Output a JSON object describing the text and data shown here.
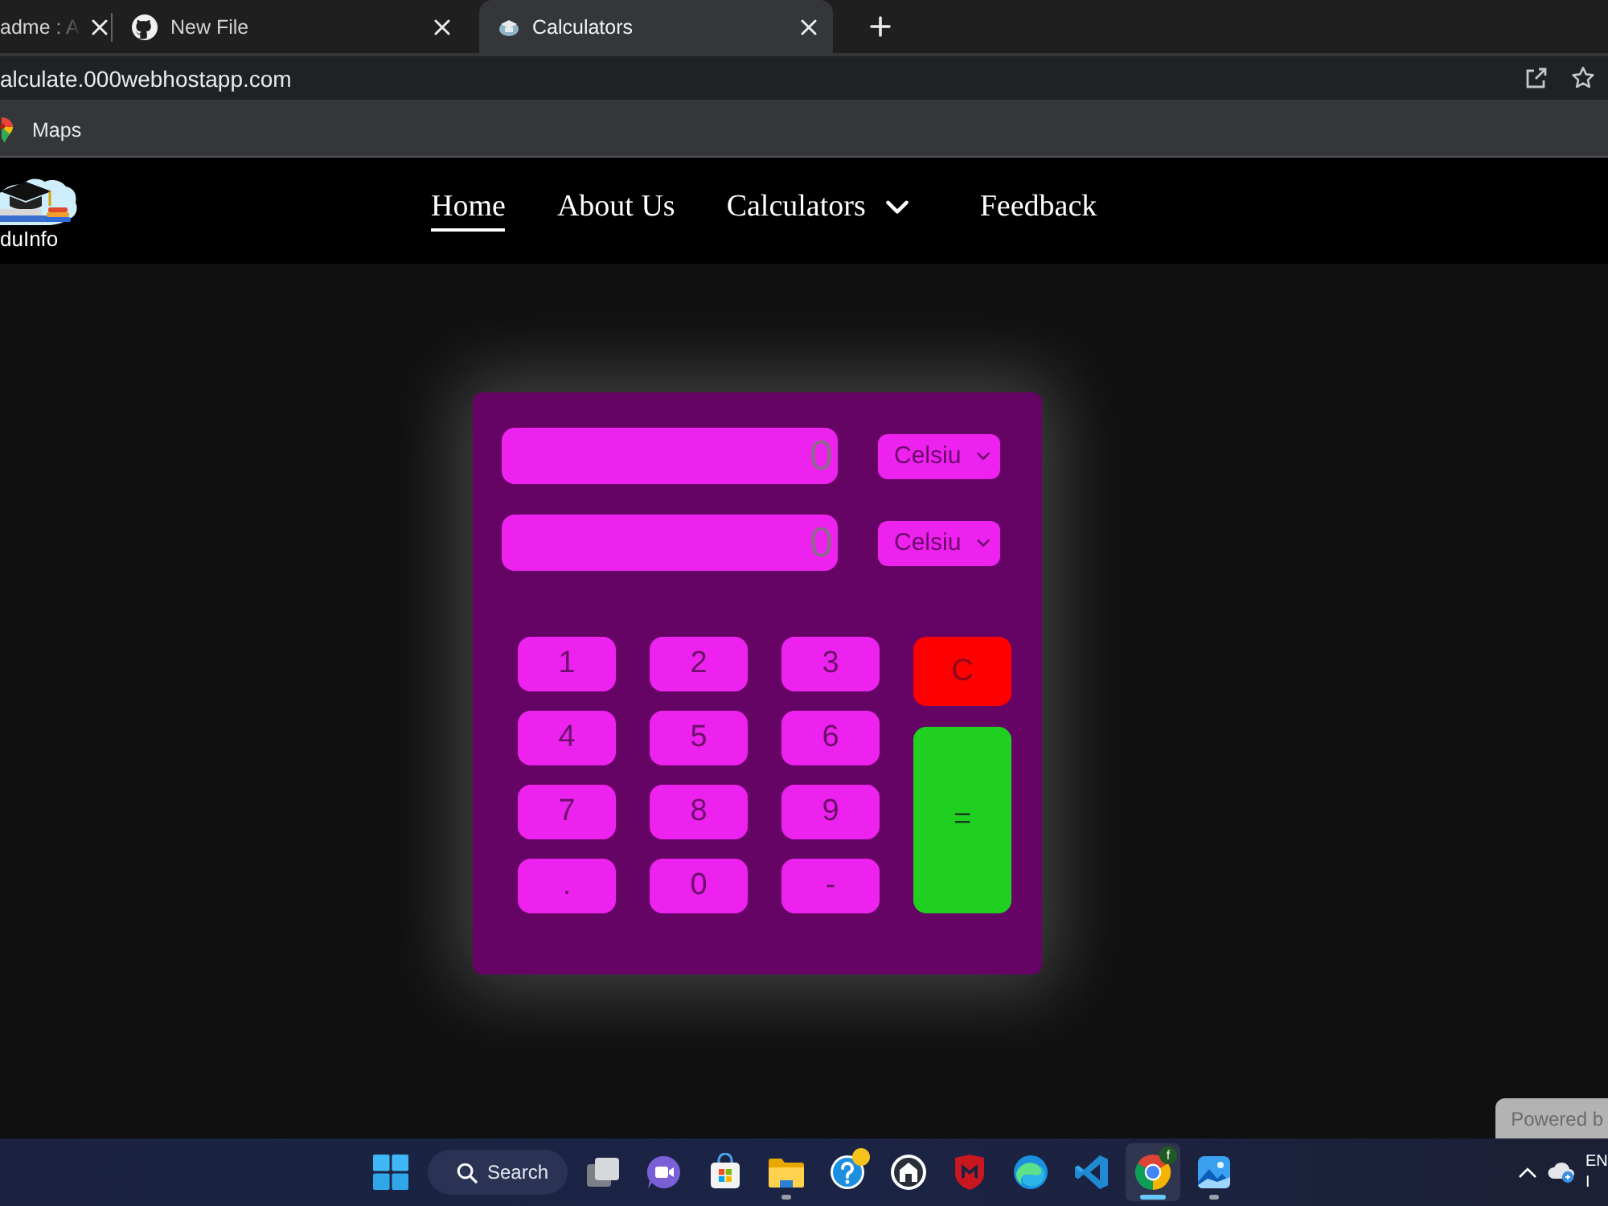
{
  "browser": {
    "tabs": [
      {
        "kind": "clipped",
        "title": "adme : A",
        "selected": false
      },
      {
        "kind": "code-host",
        "title": "New File",
        "selected": false
      },
      {
        "kind": "site",
        "title": "Calculators",
        "selected": true
      }
    ],
    "address": "alculate.000webhostapp.com",
    "bookmarks": [
      "Maps"
    ]
  },
  "site": {
    "logo_text": "duInfo",
    "nav": [
      {
        "label": "Home",
        "selected": true,
        "has_menu": false
      },
      {
        "label": "About Us",
        "selected": false,
        "has_menu": false
      },
      {
        "label": "Calculators",
        "selected": false,
        "has_menu": true
      },
      {
        "label": "Feedback",
        "selected": false,
        "has_menu": false
      }
    ]
  },
  "converter": {
    "fields": [
      {
        "placeholder": "0",
        "unit": "Celsiu"
      },
      {
        "placeholder": "0",
        "unit": "Celsiu"
      }
    ],
    "keys": [
      {
        "label": "1",
        "kind": "digit"
      },
      {
        "label": "2",
        "kind": "digit"
      },
      {
        "label": "3",
        "kind": "digit"
      },
      {
        "label": "C",
        "kind": "clear"
      },
      {
        "label": "4",
        "kind": "digit"
      },
      {
        "label": "5",
        "kind": "digit"
      },
      {
        "label": "6",
        "kind": "digit"
      },
      {
        "label": "7",
        "kind": "digit"
      },
      {
        "label": "8",
        "kind": "digit"
      },
      {
        "label": "9",
        "kind": "digit"
      },
      {
        "label": "=",
        "kind": "equals"
      },
      {
        "label": ".",
        "kind": "digit"
      },
      {
        "label": "0",
        "kind": "digit"
      },
      {
        "label": "-",
        "kind": "digit"
      }
    ]
  },
  "powered_badge": "Powered b",
  "taskbar": {
    "search": "Search",
    "apps": [
      {
        "kind": "task-view",
        "selected": false,
        "running": false,
        "notification": false
      },
      {
        "kind": "video-chat",
        "selected": false,
        "running": false,
        "notification": false
      },
      {
        "kind": "store",
        "selected": false,
        "running": false,
        "notification": false
      },
      {
        "kind": "folder",
        "selected": false,
        "running": true,
        "notification": false
      },
      {
        "kind": "help",
        "selected": false,
        "running": false,
        "notification": true
      },
      {
        "kind": "house",
        "selected": false,
        "running": false,
        "notification": false
      },
      {
        "kind": "shield",
        "selected": false,
        "running": false,
        "notification": false
      },
      {
        "kind": "swirl",
        "selected": false,
        "running": false,
        "notification": false
      },
      {
        "kind": "code-editor",
        "selected": false,
        "running": false,
        "notification": false
      },
      {
        "kind": "chrome",
        "selected": true,
        "running": true,
        "notification": false,
        "badge": "f"
      },
      {
        "kind": "photos",
        "selected": false,
        "running": true,
        "notification": false
      }
    ],
    "tray": {
      "language": "EN",
      "region": "I"
    }
  }
}
